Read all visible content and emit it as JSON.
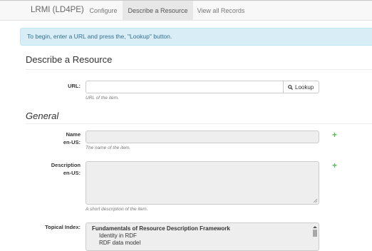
{
  "navbar": {
    "brand": "LRMI (LD4PE)",
    "items": [
      "Configure",
      "Describe a Resource",
      "View all Records"
    ]
  },
  "info_alert": "To begin, enter a URL and press the, \"Lookup\" button.",
  "page_title": "Describe a Resource",
  "url_field": {
    "label": "URL:",
    "value": "",
    "help": "URL of the item.",
    "lookup_label": "Lookup"
  },
  "general": {
    "heading": "General",
    "name": {
      "label_1": "Name",
      "label_2": "en-US:",
      "help": "The name of the item.",
      "add": "+"
    },
    "description": {
      "label_1": "Description",
      "label_2": "en-US:",
      "help": "A short description of the item.",
      "add": "+"
    },
    "topical_index": {
      "label": "Topical Index:",
      "items": [
        "Fundamentals of Resource Description Framework",
        "Identity in RDF",
        "RDF data model"
      ]
    }
  },
  "colors": {
    "info_bg": "#d9edf7",
    "info_text": "#31708f",
    "add_icon": "#5cb85c",
    "active_nav": "#e7e7e7"
  },
  "icons": {
    "lookup": "search-icon",
    "add": "plus-icon"
  }
}
